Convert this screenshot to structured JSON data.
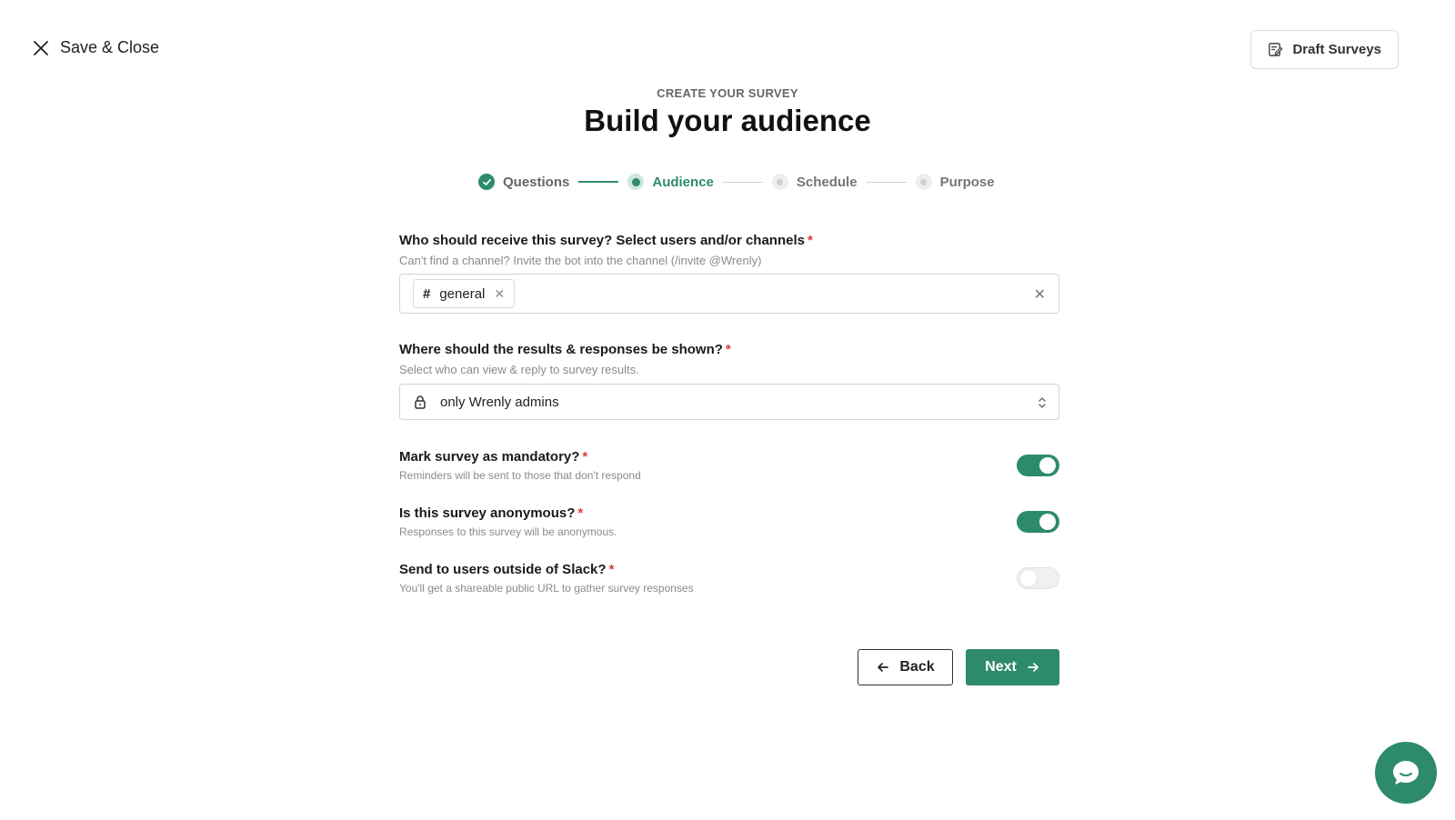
{
  "header": {
    "close_label": "Save & Close",
    "draft_label": "Draft Surveys"
  },
  "page": {
    "eyebrow": "CREATE YOUR SURVEY",
    "title": "Build your audience"
  },
  "stepper": {
    "steps": [
      {
        "label": "Questions",
        "state": "done"
      },
      {
        "label": "Audience",
        "state": "active"
      },
      {
        "label": "Schedule",
        "state": "todo"
      },
      {
        "label": "Purpose",
        "state": "todo"
      }
    ]
  },
  "recipients": {
    "label": "Who should receive this survey? Select users and/or channels",
    "required": "*",
    "hint": "Can't find a channel? Invite the bot into the channel (/invite @Wrenly)",
    "chip_prefix": "#",
    "chip_value": "general"
  },
  "visibility": {
    "label": "Where should the results & responses be shown?",
    "required": "*",
    "hint": "Select who can view & reply to survey results.",
    "selected": "only Wrenly admins"
  },
  "toggles": [
    {
      "label": "Mark survey as mandatory?",
      "required": "*",
      "hint": "Reminders will be sent to those that don't respond",
      "on": true
    },
    {
      "label": "Is this survey anonymous?",
      "required": "*",
      "hint": "Responses to this survey will be anonymous.",
      "on": true
    },
    {
      "label": "Send to users outside of Slack?",
      "required": "*",
      "hint": "You'll get a shareable public URL to gather survey responses",
      "on": false
    }
  ],
  "actions": {
    "back_label": "Back",
    "next_label": "Next"
  },
  "colors": {
    "accent": "#2e8b6a",
    "required": "#e03a3a"
  },
  "icons": {
    "close": "close-icon",
    "draft": "edit-document-icon",
    "lock": "lock-icon",
    "chat": "chat-bubble-icon"
  }
}
